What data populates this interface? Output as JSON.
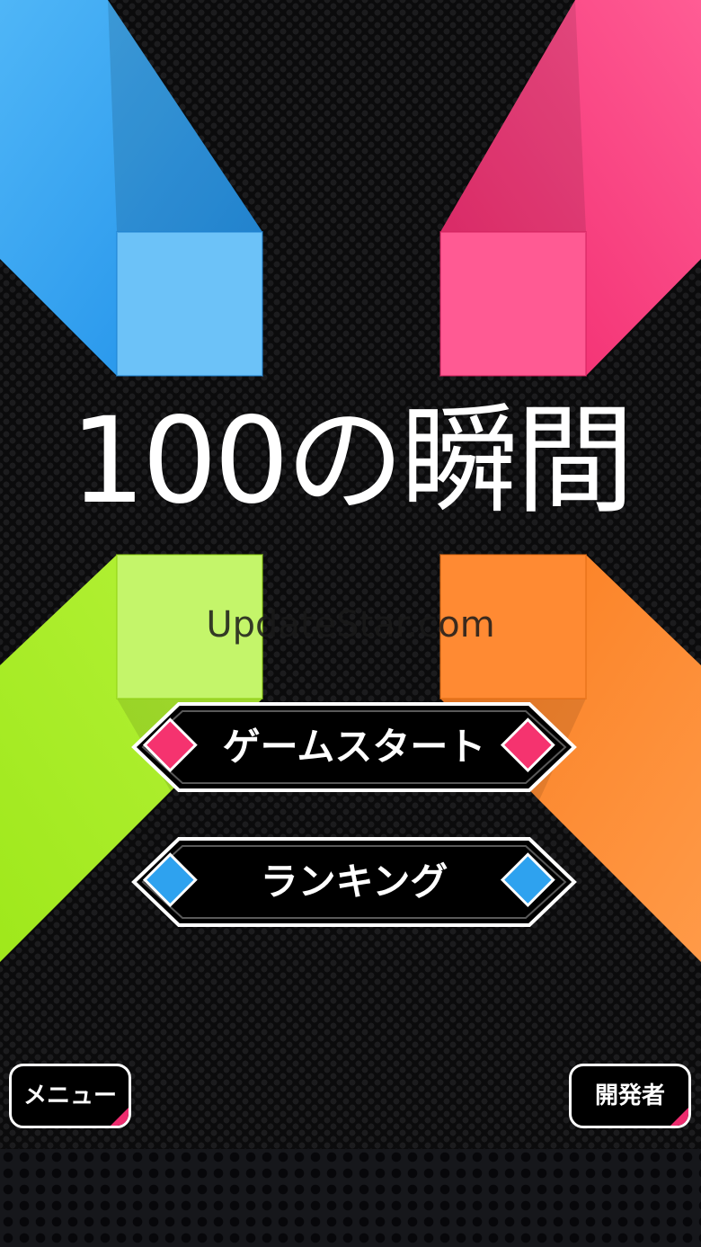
{
  "title": "100の瞬間",
  "watermark": "UpdateStar.com",
  "buttons": {
    "start_label": "ゲームスタート",
    "ranking_label": "ランキング",
    "menu_label": "メニュー",
    "developer_label": "開発者"
  },
  "colors": {
    "blue": "#2c9cf0",
    "pink": "#f53477",
    "green": "#a8ee23",
    "orange": "#fb8730",
    "start_diamond": "#f5336f",
    "ranking_diamond": "#2ea2ef"
  },
  "icons": {
    "start_left": "pink-diamond-icon",
    "start_right": "pink-diamond-icon",
    "ranking_left": "blue-diamond-icon",
    "ranking_right": "blue-diamond-icon"
  }
}
